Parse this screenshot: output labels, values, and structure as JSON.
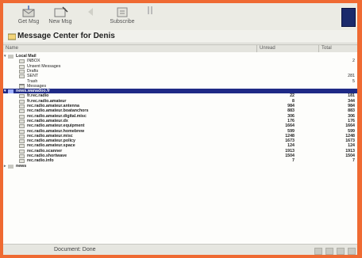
{
  "toolbar": {
    "buttons": [
      {
        "label": "Get Msg",
        "icon": "get-messages-icon"
      },
      {
        "label": "New Msg",
        "icon": "new-message-icon"
      },
      {
        "label": "",
        "icon": "reply-icon"
      },
      {
        "label": "Subscribe",
        "icon": "subscribe-icon"
      },
      {
        "label": "",
        "icon": "stop-icon"
      }
    ]
  },
  "title": "Message Center for Denis",
  "columns": {
    "name": "Name",
    "unread": "Unread",
    "total": "Total"
  },
  "rows": [
    {
      "name": "Local Mail",
      "unread": "",
      "total": "",
      "level": 0,
      "bold": true,
      "twisty": "-"
    },
    {
      "name": "INBOX",
      "unread": "",
      "total": "2",
      "level": 1
    },
    {
      "name": "Unsent Messages",
      "unread": "",
      "total": "",
      "level": 1
    },
    {
      "name": "Drafts",
      "unread": "",
      "total": "",
      "level": 1
    },
    {
      "name": "SENT",
      "unread": "",
      "total": "281",
      "level": 1
    },
    {
      "name": "Trash",
      "unread": "",
      "total": "5",
      "level": 1
    },
    {
      "name": "Messages",
      "unread": "",
      "total": "",
      "level": 1
    },
    {
      "name": "news.wanadoo.fr",
      "unread": "",
      "total": "",
      "level": 0,
      "bold": true,
      "selected": true,
      "twisty": "-"
    },
    {
      "name": "fr.rec.radio",
      "unread": "22",
      "total": "181",
      "level": 1,
      "bold": true
    },
    {
      "name": "fr.rec.radio.amateur",
      "unread": "8",
      "total": "344",
      "level": 1,
      "bold": true
    },
    {
      "name": "rec.radio.amateur.antenna",
      "unread": "984",
      "total": "984",
      "level": 1,
      "bold": true
    },
    {
      "name": "rec.radio.amateur.boatanchors",
      "unread": "883",
      "total": "883",
      "level": 1,
      "bold": true
    },
    {
      "name": "rec.radio.amateur.digital.misc",
      "unread": "306",
      "total": "306",
      "level": 1,
      "bold": true
    },
    {
      "name": "rec.radio.amateur.dx",
      "unread": "176",
      "total": "176",
      "level": 1,
      "bold": true
    },
    {
      "name": "rec.radio.amateur.equipment",
      "unread": "1664",
      "total": "1664",
      "level": 1,
      "bold": true
    },
    {
      "name": "rec.radio.amateur.homebrew",
      "unread": "599",
      "total": "599",
      "level": 1,
      "bold": true
    },
    {
      "name": "rec.radio.amateur.misc",
      "unread": "1248",
      "total": "1248",
      "level": 1,
      "bold": true
    },
    {
      "name": "rec.radio.amateur.policy",
      "unread": "1673",
      "total": "1673",
      "level": 1,
      "bold": true
    },
    {
      "name": "rec.radio.amateur.space",
      "unread": "124",
      "total": "124",
      "level": 1,
      "bold": true
    },
    {
      "name": "rec.radio.scanner",
      "unread": "1913",
      "total": "1913",
      "level": 1,
      "bold": true
    },
    {
      "name": "rec.radio.shortwave",
      "unread": "1504",
      "total": "1504",
      "level": 1,
      "bold": true
    },
    {
      "name": "rec.radio.info",
      "unread": "7",
      "total": "7",
      "level": 1,
      "bold": true
    },
    {
      "name": "news",
      "unread": "",
      "total": "",
      "level": 0,
      "bold": true,
      "twisty": "+"
    }
  ],
  "status": {
    "text": "Document: Done"
  },
  "colors": {
    "frame": "#ef6a32",
    "selection": "#1f2a86"
  }
}
